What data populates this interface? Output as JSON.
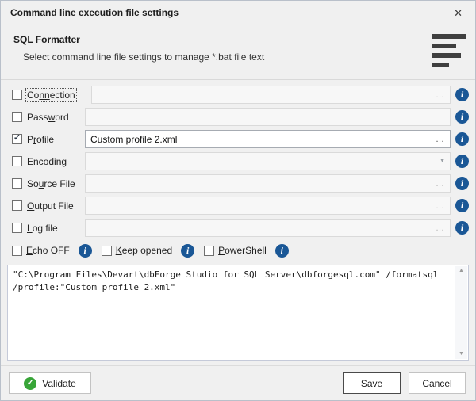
{
  "dialog": {
    "title": "Command line execution file settings"
  },
  "header": {
    "title": "SQL Formatter",
    "subtitle": "Select command line file settings to manage *.bat file text"
  },
  "icons": {
    "close": "✕",
    "ellipsis": "…",
    "dropdown": "▼",
    "check": "✓",
    "info": "i",
    "validate_check": "✓",
    "scroll_up": "▲",
    "scroll_down": "▼"
  },
  "form": {
    "rows": [
      {
        "pre": "Co",
        "mn": "nn",
        "post": "ection",
        "checked": false,
        "enabled": false,
        "control": "ellipsis",
        "value": ""
      },
      {
        "pre": "Pass",
        "mn": "w",
        "post": "ord",
        "checked": false,
        "enabled": false,
        "control": "none",
        "value": ""
      },
      {
        "pre": "P",
        "mn": "r",
        "post": "ofile",
        "checked": true,
        "enabled": true,
        "control": "ellipsis",
        "value": "Custom profile 2.xml"
      },
      {
        "pre": "Encodin",
        "mn": "g",
        "post": "",
        "checked": false,
        "enabled": false,
        "control": "dropdown",
        "value": ""
      },
      {
        "pre": "So",
        "mn": "u",
        "post": "rce File",
        "checked": false,
        "enabled": false,
        "control": "ellipsis",
        "value": ""
      },
      {
        "pre": "",
        "mn": "O",
        "post": "utput File",
        "checked": false,
        "enabled": false,
        "control": "ellipsis",
        "value": ""
      },
      {
        "pre": "",
        "mn": "L",
        "post": "og file",
        "checked": false,
        "enabled": false,
        "control": "ellipsis",
        "value": ""
      }
    ],
    "options": [
      {
        "pre": "",
        "mn": "E",
        "post": "cho OFF"
      },
      {
        "pre": "",
        "mn": "K",
        "post": "eep opened"
      },
      {
        "pre": "",
        "mn": "P",
        "post": "owerShell"
      }
    ]
  },
  "command": {
    "text": "\"C:\\Program Files\\Devart\\dbForge Studio for SQL Server\\dbforgesql.com\" /formatsql\n/profile:\"Custom profile 2.xml\""
  },
  "footer": {
    "validate": {
      "pre": "",
      "mn": "V",
      "post": "alidate"
    },
    "save": {
      "pre": "",
      "mn": "S",
      "post": "ave"
    },
    "cancel": {
      "pre": "",
      "mn": "C",
      "post": "ancel"
    }
  },
  "colors": {
    "info_blue": "#1a5796",
    "validate_green": "#38a538",
    "accent_dark_border": "#4a4a4a"
  }
}
